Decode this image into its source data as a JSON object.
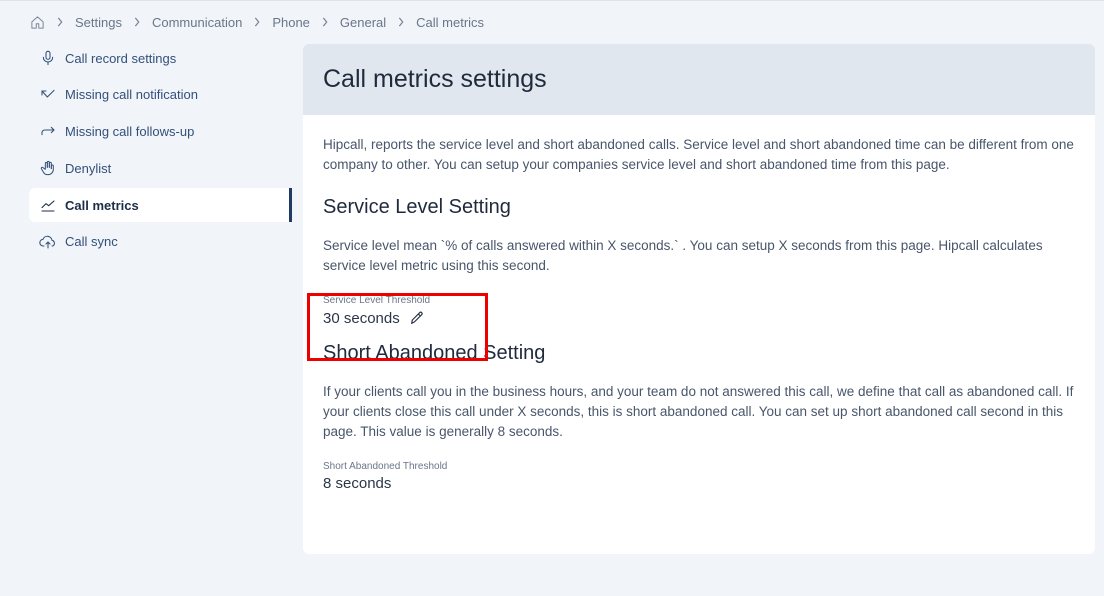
{
  "breadcrumb": {
    "home_icon": "home-icon",
    "items": [
      "Settings",
      "Communication",
      "Phone",
      "General",
      "Call metrics"
    ]
  },
  "sidebar": {
    "items": [
      {
        "label": "Call record settings",
        "icon": "microphone-icon"
      },
      {
        "label": "Missing call notification",
        "icon": "missed-call-icon"
      },
      {
        "label": "Missing call follows-up",
        "icon": "forward-arrow-icon"
      },
      {
        "label": "Denylist",
        "icon": "hand-icon"
      },
      {
        "label": "Call metrics",
        "icon": "chart-line-icon",
        "active": true
      },
      {
        "label": "Call sync",
        "icon": "cloud-upload-icon"
      }
    ]
  },
  "main": {
    "title": "Call metrics settings",
    "intro": "Hipcall, reports the service level and short abandoned calls. Service level and short abandoned time can be different from one company to other. You can setup your companies service level and short abandoned time from this page.",
    "service_level": {
      "heading": "Service Level Setting",
      "description": "Service level mean `% of calls answered within X seconds.` . You can setup X seconds from this page. Hipcall calculates service level metric using this second.",
      "field_label": "Service Level Threshold",
      "field_value": "30 seconds",
      "edit_icon": "pencil-icon"
    },
    "short_abandoned": {
      "heading": "Short Abandoned Setting",
      "description": "If your clients call you in the business hours, and your team do not answered this call, we define that call as abandoned call. If your clients close this call under X seconds, this is short abandoned call. You can set up short abandoned call second in this page. This value is generally 8 seconds.",
      "field_label": "Short Abandoned Threshold",
      "field_value": "8 seconds"
    }
  },
  "colors": {
    "accent": "#1f3a63",
    "highlight": "#ee0000",
    "header_bg": "#e1e7ef",
    "page_bg": "#f1f4f8"
  }
}
